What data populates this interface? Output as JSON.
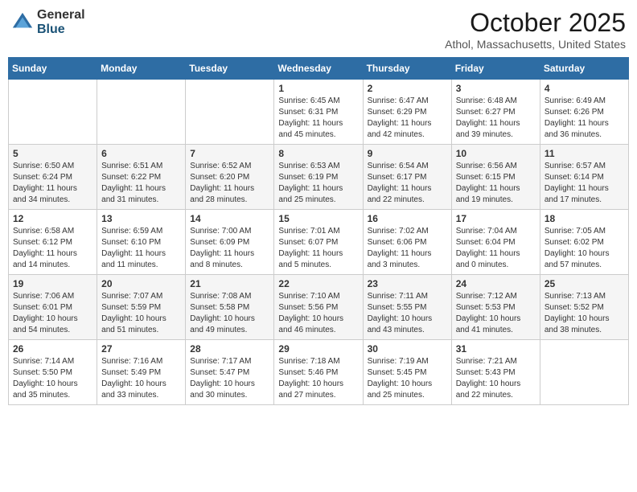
{
  "header": {
    "logo_general": "General",
    "logo_blue": "Blue",
    "month_title": "October 2025",
    "location": "Athol, Massachusetts, United States"
  },
  "weekdays": [
    "Sunday",
    "Monday",
    "Tuesday",
    "Wednesday",
    "Thursday",
    "Friday",
    "Saturday"
  ],
  "weeks": [
    [
      {
        "day": "",
        "info": ""
      },
      {
        "day": "",
        "info": ""
      },
      {
        "day": "",
        "info": ""
      },
      {
        "day": "1",
        "info": "Sunrise: 6:45 AM\nSunset: 6:31 PM\nDaylight: 11 hours\nand 45 minutes."
      },
      {
        "day": "2",
        "info": "Sunrise: 6:47 AM\nSunset: 6:29 PM\nDaylight: 11 hours\nand 42 minutes."
      },
      {
        "day": "3",
        "info": "Sunrise: 6:48 AM\nSunset: 6:27 PM\nDaylight: 11 hours\nand 39 minutes."
      },
      {
        "day": "4",
        "info": "Sunrise: 6:49 AM\nSunset: 6:26 PM\nDaylight: 11 hours\nand 36 minutes."
      }
    ],
    [
      {
        "day": "5",
        "info": "Sunrise: 6:50 AM\nSunset: 6:24 PM\nDaylight: 11 hours\nand 34 minutes."
      },
      {
        "day": "6",
        "info": "Sunrise: 6:51 AM\nSunset: 6:22 PM\nDaylight: 11 hours\nand 31 minutes."
      },
      {
        "day": "7",
        "info": "Sunrise: 6:52 AM\nSunset: 6:20 PM\nDaylight: 11 hours\nand 28 minutes."
      },
      {
        "day": "8",
        "info": "Sunrise: 6:53 AM\nSunset: 6:19 PM\nDaylight: 11 hours\nand 25 minutes."
      },
      {
        "day": "9",
        "info": "Sunrise: 6:54 AM\nSunset: 6:17 PM\nDaylight: 11 hours\nand 22 minutes."
      },
      {
        "day": "10",
        "info": "Sunrise: 6:56 AM\nSunset: 6:15 PM\nDaylight: 11 hours\nand 19 minutes."
      },
      {
        "day": "11",
        "info": "Sunrise: 6:57 AM\nSunset: 6:14 PM\nDaylight: 11 hours\nand 17 minutes."
      }
    ],
    [
      {
        "day": "12",
        "info": "Sunrise: 6:58 AM\nSunset: 6:12 PM\nDaylight: 11 hours\nand 14 minutes."
      },
      {
        "day": "13",
        "info": "Sunrise: 6:59 AM\nSunset: 6:10 PM\nDaylight: 11 hours\nand 11 minutes."
      },
      {
        "day": "14",
        "info": "Sunrise: 7:00 AM\nSunset: 6:09 PM\nDaylight: 11 hours\nand 8 minutes."
      },
      {
        "day": "15",
        "info": "Sunrise: 7:01 AM\nSunset: 6:07 PM\nDaylight: 11 hours\nand 5 minutes."
      },
      {
        "day": "16",
        "info": "Sunrise: 7:02 AM\nSunset: 6:06 PM\nDaylight: 11 hours\nand 3 minutes."
      },
      {
        "day": "17",
        "info": "Sunrise: 7:04 AM\nSunset: 6:04 PM\nDaylight: 11 hours\nand 0 minutes."
      },
      {
        "day": "18",
        "info": "Sunrise: 7:05 AM\nSunset: 6:02 PM\nDaylight: 10 hours\nand 57 minutes."
      }
    ],
    [
      {
        "day": "19",
        "info": "Sunrise: 7:06 AM\nSunset: 6:01 PM\nDaylight: 10 hours\nand 54 minutes."
      },
      {
        "day": "20",
        "info": "Sunrise: 7:07 AM\nSunset: 5:59 PM\nDaylight: 10 hours\nand 51 minutes."
      },
      {
        "day": "21",
        "info": "Sunrise: 7:08 AM\nSunset: 5:58 PM\nDaylight: 10 hours\nand 49 minutes."
      },
      {
        "day": "22",
        "info": "Sunrise: 7:10 AM\nSunset: 5:56 PM\nDaylight: 10 hours\nand 46 minutes."
      },
      {
        "day": "23",
        "info": "Sunrise: 7:11 AM\nSunset: 5:55 PM\nDaylight: 10 hours\nand 43 minutes."
      },
      {
        "day": "24",
        "info": "Sunrise: 7:12 AM\nSunset: 5:53 PM\nDaylight: 10 hours\nand 41 minutes."
      },
      {
        "day": "25",
        "info": "Sunrise: 7:13 AM\nSunset: 5:52 PM\nDaylight: 10 hours\nand 38 minutes."
      }
    ],
    [
      {
        "day": "26",
        "info": "Sunrise: 7:14 AM\nSunset: 5:50 PM\nDaylight: 10 hours\nand 35 minutes."
      },
      {
        "day": "27",
        "info": "Sunrise: 7:16 AM\nSunset: 5:49 PM\nDaylight: 10 hours\nand 33 minutes."
      },
      {
        "day": "28",
        "info": "Sunrise: 7:17 AM\nSunset: 5:47 PM\nDaylight: 10 hours\nand 30 minutes."
      },
      {
        "day": "29",
        "info": "Sunrise: 7:18 AM\nSunset: 5:46 PM\nDaylight: 10 hours\nand 27 minutes."
      },
      {
        "day": "30",
        "info": "Sunrise: 7:19 AM\nSunset: 5:45 PM\nDaylight: 10 hours\nand 25 minutes."
      },
      {
        "day": "31",
        "info": "Sunrise: 7:21 AM\nSunset: 5:43 PM\nDaylight: 10 hours\nand 22 minutes."
      },
      {
        "day": "",
        "info": ""
      }
    ]
  ]
}
